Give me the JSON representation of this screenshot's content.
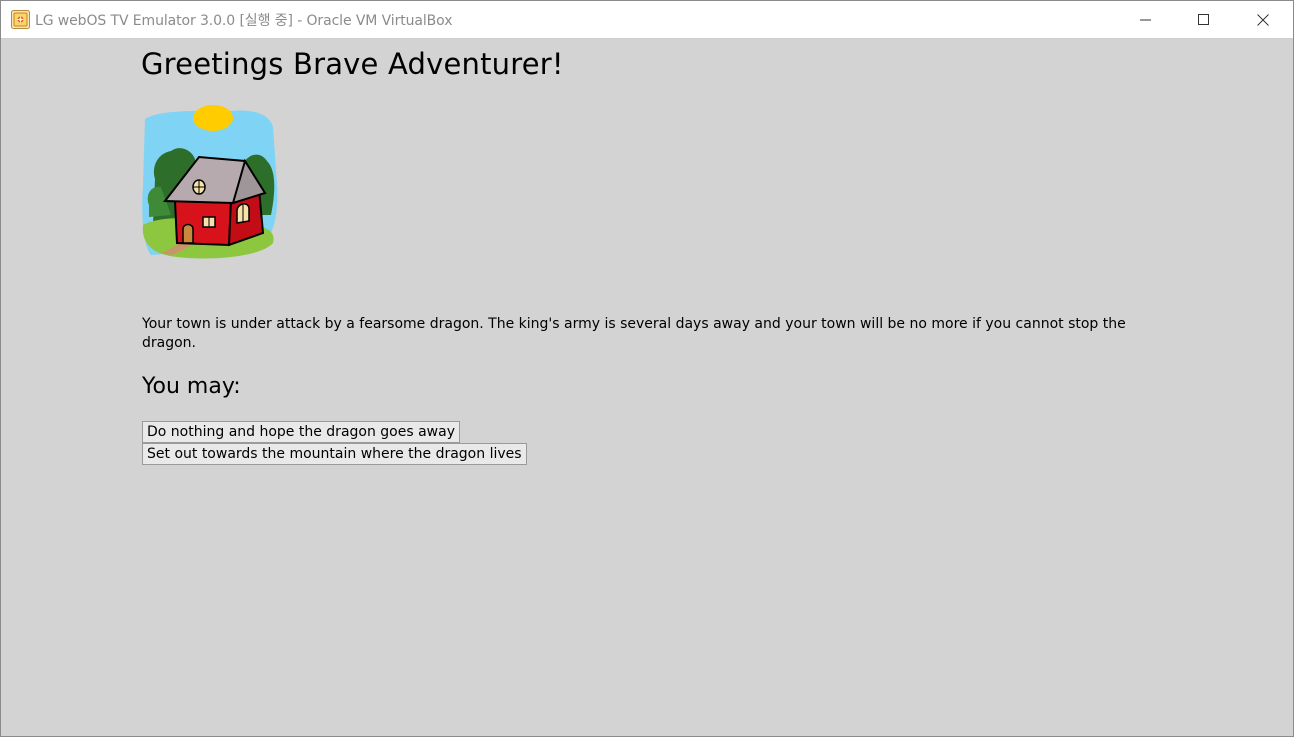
{
  "window": {
    "title": "LG webOS TV Emulator 3.0.0 [실행 중] - Oracle VM VirtualBox",
    "icon": "virtualbox-app-icon",
    "controls": {
      "minimize_icon": "minimize-icon",
      "maximize_icon": "maximize-icon",
      "close_icon": "close-icon"
    }
  },
  "page": {
    "title": "Greetings Brave Adventurer!",
    "image": "house-illustration",
    "story": "Your town is under attack by a fearsome dragon. The king's army is several days away and your town will be no more if you cannot stop the dragon.",
    "subheading": "You may:",
    "choices": [
      {
        "label": "Do nothing and hope the dragon goes away"
      },
      {
        "label": "Set out towards the mountain where the dragon lives"
      }
    ]
  },
  "colors": {
    "background": "#d3d3d3",
    "titlebar": "#ffffff",
    "title_text": "#8b8b8b",
    "house_red": "#d8121b",
    "roof": "#b6aaae",
    "grass": "#8dc63f",
    "sky": "#7fd3f4",
    "sun": "#ffcc00"
  }
}
